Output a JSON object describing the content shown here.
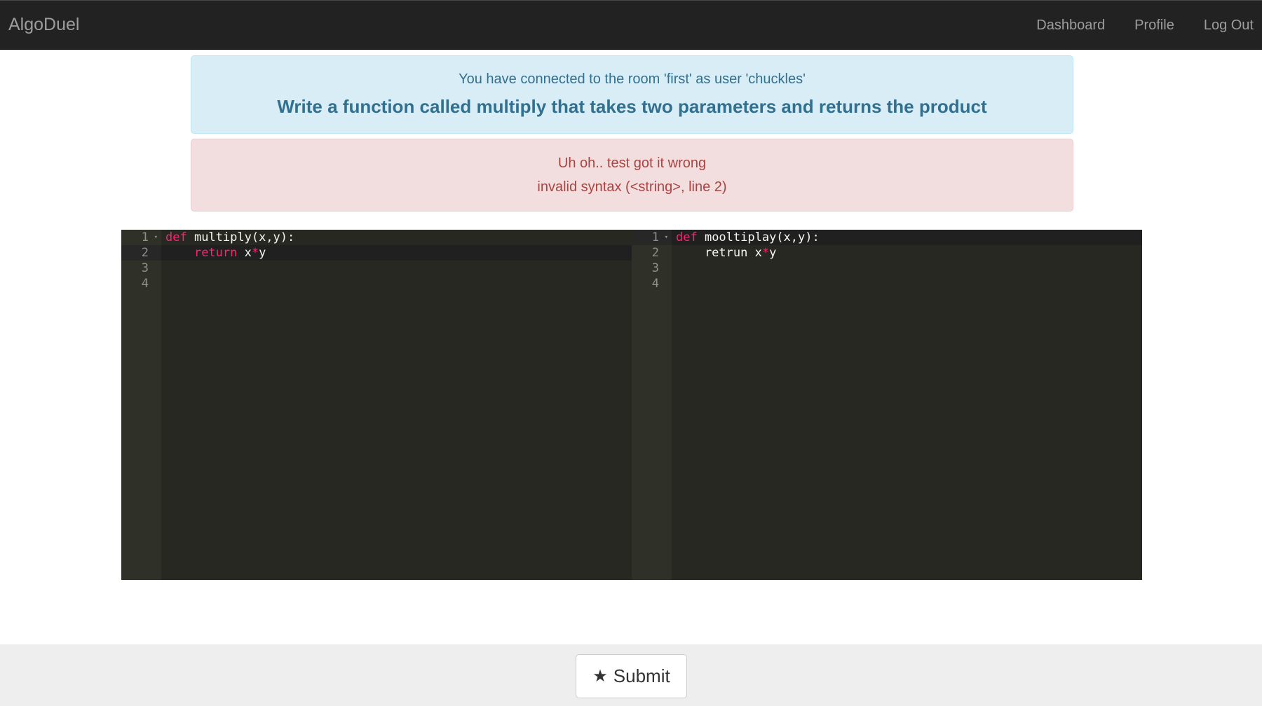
{
  "navbar": {
    "brand": "AlgoDuel",
    "links": [
      "Dashboard",
      "Profile",
      "Log Out"
    ]
  },
  "info_alert": {
    "message": "You have connected to the room 'first' as user 'chuckles'",
    "problem": "Write a function called multiply that takes two parameters and returns the product"
  },
  "error_alert": {
    "line1": "Uh oh.. test got it wrong",
    "line2": "invalid syntax (<string>, line 2)"
  },
  "editors": {
    "left": {
      "line_numbers": [
        "1",
        "2",
        "3",
        "4"
      ],
      "active_line": 2,
      "lines": [
        [
          {
            "t": "kw",
            "v": "def"
          },
          {
            "t": "plain",
            "v": " multiply(x,y):"
          }
        ],
        [
          {
            "t": "plain",
            "v": "    "
          },
          {
            "t": "kw",
            "v": "return"
          },
          {
            "t": "plain",
            "v": " x"
          },
          {
            "t": "op",
            "v": "*"
          },
          {
            "t": "plain",
            "v": "y"
          }
        ],
        [],
        []
      ]
    },
    "right": {
      "line_numbers": [
        "1",
        "2",
        "3",
        "4"
      ],
      "active_line": 1,
      "lines": [
        [
          {
            "t": "kw",
            "v": "def"
          },
          {
            "t": "plain",
            "v": " mooltiplay(x,y):"
          }
        ],
        [
          {
            "t": "plain",
            "v": "    retrun x"
          },
          {
            "t": "op",
            "v": "*"
          },
          {
            "t": "plain",
            "v": "y"
          }
        ],
        [],
        []
      ]
    }
  },
  "footer": {
    "submit_label": "Submit",
    "submit_icon": "star-icon"
  },
  "colors": {
    "navbar_bg": "#222222",
    "info_bg": "#d9edf7",
    "info_text": "#31708f",
    "danger_bg": "#f2dede",
    "danger_text": "#a94442",
    "editor_bg": "#272822",
    "keyword": "#f92672"
  }
}
